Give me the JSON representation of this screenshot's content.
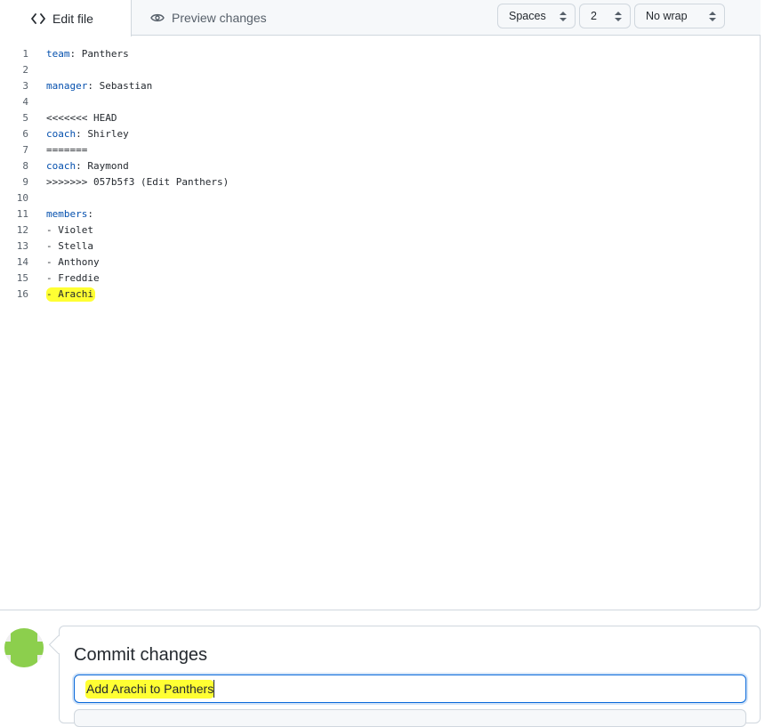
{
  "tabs": {
    "edit_label": "Edit file",
    "preview_label": "Preview changes"
  },
  "controls": {
    "indent_mode": "Spaces",
    "indent_size": "2",
    "wrap_mode": "No wrap"
  },
  "code_lines": [
    {
      "num": "1",
      "key": "team",
      "rest": ": Panthers"
    },
    {
      "num": "2",
      "key": "",
      "rest": ""
    },
    {
      "num": "3",
      "key": "manager",
      "rest": ": Sebastian"
    },
    {
      "num": "4",
      "key": "",
      "rest": ""
    },
    {
      "num": "5",
      "key": "",
      "rest": "<<<<<<< HEAD"
    },
    {
      "num": "6",
      "key": "coach",
      "rest": ": Shirley"
    },
    {
      "num": "7",
      "key": "",
      "rest": "======="
    },
    {
      "num": "8",
      "key": "coach",
      "rest": ": Raymond"
    },
    {
      "num": "9",
      "key": "",
      "rest": ">>>>>>> 057b5f3 (Edit Panthers)"
    },
    {
      "num": "10",
      "key": "",
      "rest": ""
    },
    {
      "num": "11",
      "key": "members",
      "rest": ":"
    },
    {
      "num": "12",
      "key": "",
      "rest": "- Violet"
    },
    {
      "num": "13",
      "key": "",
      "rest": "- Stella"
    },
    {
      "num": "14",
      "key": "",
      "rest": "- Anthony"
    },
    {
      "num": "15",
      "key": "",
      "rest": "- Freddie"
    },
    {
      "num": "16",
      "key": "",
      "rest": "- Arachi",
      "highlight": true
    }
  ],
  "commit": {
    "title": "Commit changes",
    "message_value": "Add Arachi to Panthers"
  },
  "colors": {
    "highlight": "#ffff33",
    "key": "#0550ae",
    "focus_border": "#0969da",
    "avatar_green": "#8ccf4d"
  }
}
